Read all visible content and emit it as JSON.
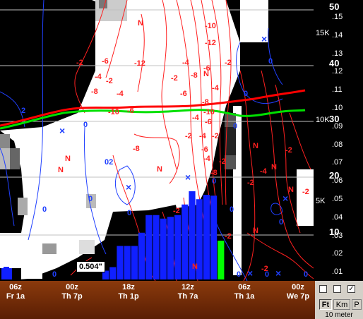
{
  "right_axis": {
    "labels_big": [
      "50",
      "40",
      "30",
      "20",
      "10"
    ],
    "labels_small": [
      ".15",
      ".14",
      ".13",
      ".12",
      ".11",
      ".10",
      ".09",
      ".08",
      ".07",
      ".06",
      ".05",
      ".04",
      ".03",
      ".02",
      ".01"
    ],
    "labels_mid": [
      "15K",
      "10K",
      "5K"
    ]
  },
  "time_axis": {
    "ticks": [
      {
        "hour": "06z",
        "day": "Fr 1a"
      },
      {
        "hour": "00z",
        "day": "Th 7p"
      },
      {
        "hour": "18z",
        "day": "Th 1p"
      },
      {
        "hour": "12z",
        "day": "Th 7a"
      },
      {
        "hour": "06z",
        "day": "Th 1a"
      },
      {
        "hour": "00z",
        "day": "We 7p"
      }
    ]
  },
  "tooltip": "0.504\"",
  "controls": {
    "checkbox_checked_mark": "✓",
    "units": [
      "Ft",
      "Km",
      "P"
    ],
    "active_unit": "Ft",
    "height_label": "10 meter"
  },
  "contour_labels": {
    "red_values": [
      "-2",
      "-4",
      "-6",
      "-8",
      "-10",
      "-12",
      "-2",
      "-4",
      "-6",
      "-8",
      "-2",
      "-4",
      "-6",
      "-8",
      "-10",
      "-12",
      "-4",
      "-6",
      "-8",
      "-2",
      "-4",
      "-6",
      "-10",
      "-2",
      "-4",
      "-2",
      "-6",
      "-8",
      "-4",
      "-2",
      "-2",
      "-4",
      "-2",
      "-2",
      "-2",
      "-2",
      "-2"
    ],
    "blue_values": [
      "2",
      "0",
      "0",
      "0",
      "0",
      "0",
      "0",
      "0",
      "0",
      "0",
      "0",
      "0",
      "0",
      "02",
      "0",
      "0"
    ],
    "n_marker": "N",
    "x_marker": "×"
  },
  "colors": {
    "red_contour": "#ff2020",
    "blue_contour": "#2040ff",
    "thick_red": "#ff0000",
    "thick_green": "#00e000",
    "precip_bar": "#1020ff",
    "precip_highlight": "#00ff00"
  },
  "precip_bars_relative_height": [
    0.1,
    0.14,
    0.38,
    0.38,
    0.38,
    0.53,
    0.73,
    0.73,
    0.69,
    0.71,
    0.73,
    0.85,
    1.0,
    0.91,
    0.96,
    0.95,
    0.44
  ]
}
